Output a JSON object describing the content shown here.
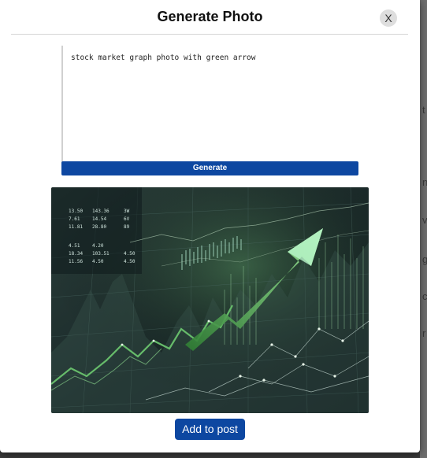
{
  "modal": {
    "title": "Generate Photo",
    "close_label": "X"
  },
  "prompt": {
    "value": "stock market graph photo with green arrow"
  },
  "generate_label": "Generate",
  "image": {
    "ticker_rows": [
      [
        "13.50",
        "143.36",
        "3W"
      ],
      [
        "7.61",
        "14.54",
        "6V"
      ],
      [
        "11.81",
        "28.80",
        "89"
      ],
      [
        "4.51",
        "4.20",
        ""
      ],
      [
        "18.34",
        "103.51",
        "4.50"
      ],
      [
        "11.56",
        "4.50",
        "4.50"
      ]
    ]
  },
  "add_to_post_label": "Add to post",
  "colors": {
    "primary": "#0d47a1",
    "chart_green": "#4caf50",
    "chart_bg": "#1b2a2a"
  }
}
